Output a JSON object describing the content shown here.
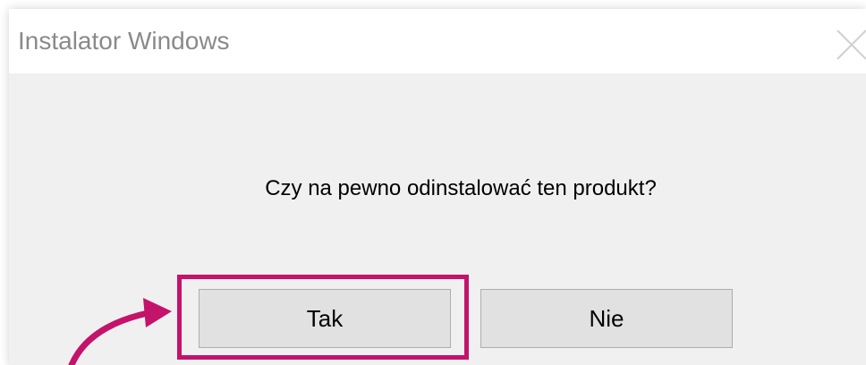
{
  "window": {
    "title": "Instalator Windows"
  },
  "dialog": {
    "message": "Czy na pewno odinstalować ten produkt?",
    "yes_label": "Tak",
    "no_label": "Nie"
  },
  "icons": {
    "close": "close-icon",
    "annotation": "arrow-icon"
  },
  "colors": {
    "highlight": "#c4136b",
    "dialog_bg": "#f0f0f0",
    "button_bg": "#e1e1e1"
  }
}
